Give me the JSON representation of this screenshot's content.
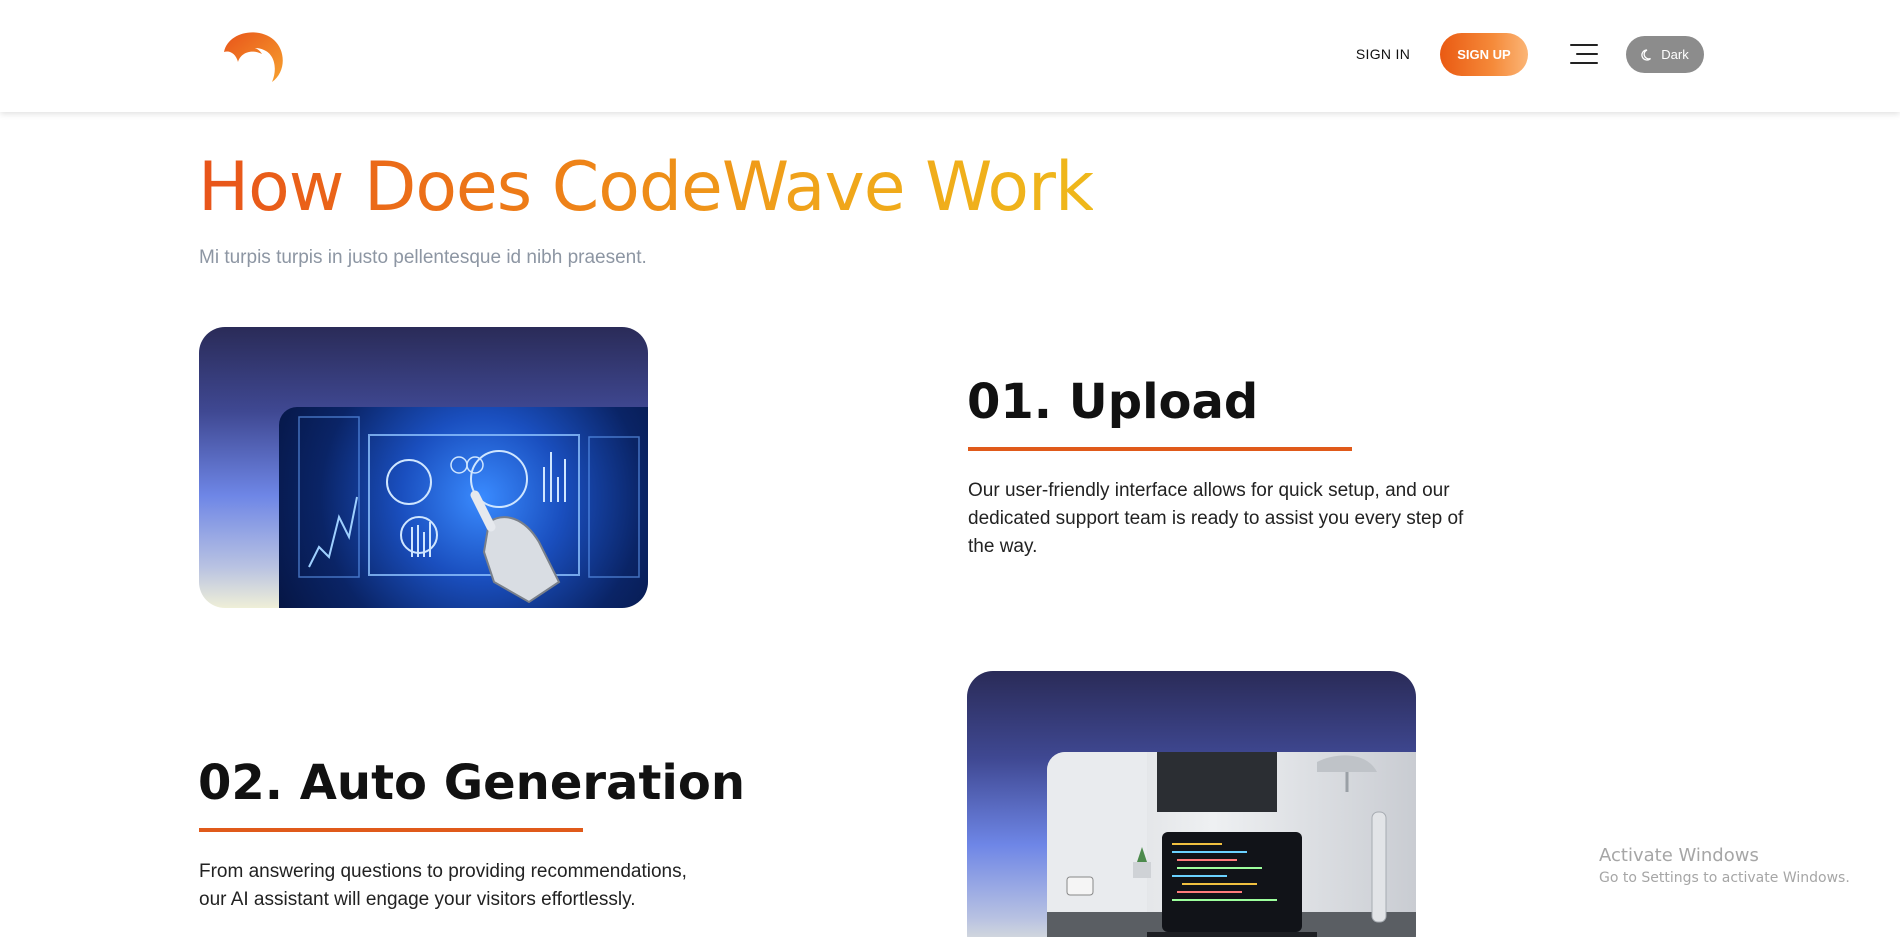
{
  "header": {
    "logo_icon": "wave-logo-icon",
    "signin_label": "SIGN IN",
    "signup_label": "SIGN UP",
    "menu_icon": "hamburger-menu-icon",
    "theme_toggle": {
      "icon": "moon-icon",
      "label": "Dark"
    }
  },
  "hero": {
    "title": "How Does CodeWave Work",
    "subtitle": "Mi turpis turpis in justo pellentesque id nibh praesent."
  },
  "steps": [
    {
      "title": "01. Upload",
      "description": "Our user-friendly interface allows for quick setup, and our dedicated support team is ready to assist you every step of the way.",
      "image_icon": "robot-hand-dashboard-image"
    },
    {
      "title": "02. Auto Generation",
      "description": "From answering questions to providing recommendations, our AI assistant will engage your visitors effortlessly.",
      "image_icon": "laptop-desk-image"
    }
  ],
  "watermark": {
    "line1": "Activate Windows",
    "line2": "Go to Settings to activate Windows."
  },
  "colors": {
    "accent": "#e8541a",
    "accent_light": "#f0a51a",
    "rule": "#e05a1a",
    "toggle_bg": "#8c8c8c"
  }
}
